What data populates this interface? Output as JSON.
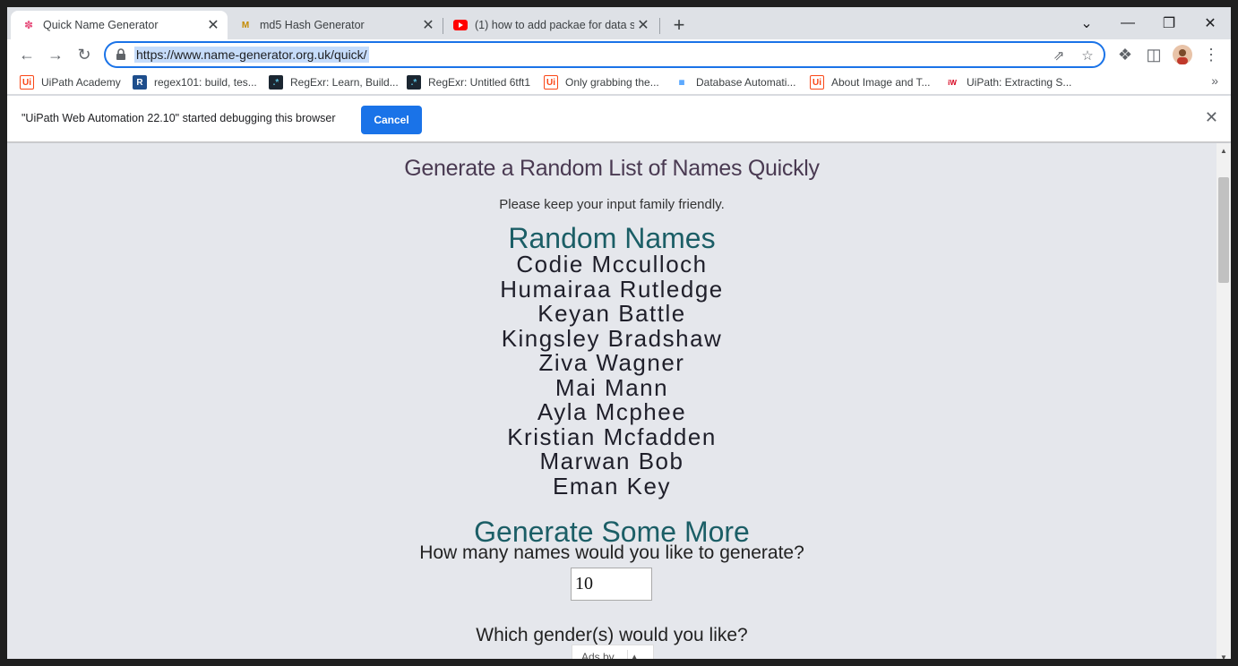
{
  "tabs": [
    {
      "title": "Quick Name Generator",
      "icon": "flamingo-icon"
    },
    {
      "title": "md5 Hash Generator",
      "icon": "md5-icon"
    },
    {
      "title": "(1) how to add packae for data sc",
      "icon": "youtube-icon"
    }
  ],
  "address_bar": {
    "url": "https://www.name-generator.org.uk/quick/"
  },
  "bookmarks": [
    "UiPath Academy",
    "regex101: build, tes...",
    "RegExr: Learn, Build...",
    "RegExr: Untitled 6tft1",
    "Only grabbing the...",
    "Database Automati...",
    "About Image and T...",
    "UiPath: Extracting S..."
  ],
  "infobar": {
    "message": "\"UiPath Web Automation 22.10\" started debugging this browser",
    "cancel_label": "Cancel"
  },
  "page": {
    "heading": "Generate a Random List of Names Quickly",
    "note": "Please keep your input family friendly.",
    "random_names_title": "Random Names",
    "names": [
      "Codie Mcculloch",
      "Humairaa Rutledge",
      "Keyan Battle",
      "Kingsley Bradshaw",
      "Ziva Wagner",
      "Mai Mann",
      "Ayla Mcphee",
      "Kristian Mcfadden",
      "Marwan Bob",
      "Eman Key"
    ],
    "generate_more_title": "Generate Some More",
    "count_question": "How many names would you like to generate?",
    "count_value": "10",
    "gender_question": "Which gender(s) would you like?",
    "ads_label": "Ads by"
  }
}
